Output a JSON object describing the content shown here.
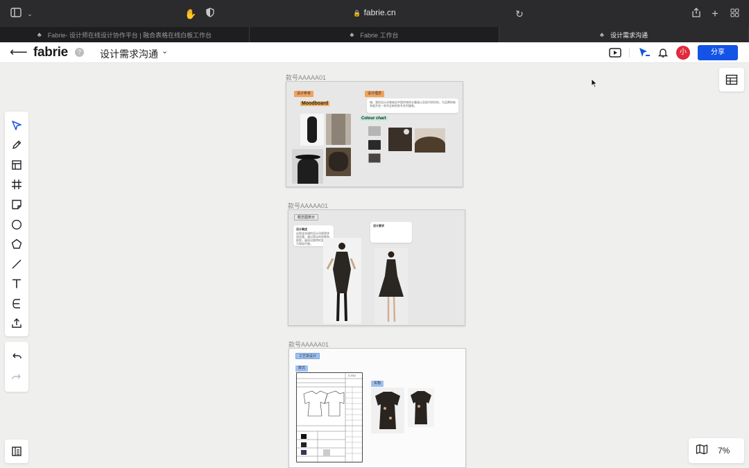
{
  "browser": {
    "url": "fabrie.cn",
    "tabs": [
      {
        "title": "Fabrie- 设计师在线设计协作平台 | 融合表格在线白板工作台",
        "active": false
      },
      {
        "title": "Fabrie 工作台",
        "active": false
      },
      {
        "title": "设计需求沟通",
        "active": true
      }
    ]
  },
  "app": {
    "logo": "fabrie",
    "help": "?",
    "doc_title": "设计需求沟通",
    "avatar_initial": "小",
    "share_label": "分享",
    "accent": "#1354e6",
    "avatar_color": "#e02a3d"
  },
  "toolbar": {
    "tools": [
      "select-icon",
      "pen-icon",
      "layout-icon",
      "frame-icon",
      "sticky-note-icon",
      "circle-icon",
      "pentagon-icon",
      "line-icon",
      "text-icon",
      "connector-icon",
      "upload-icon"
    ],
    "history": [
      "undo-icon",
      "redo-icon"
    ]
  },
  "canvas": {
    "zoom": "7%",
    "frames": [
      {
        "label": "款号AAAAA01",
        "tag_left": "设计参考",
        "tag_right": "设计理念",
        "moodboard": "Moodboard",
        "colour_chart": "Colour chart",
        "note_text": "嗨，我的设计灵感来自中国传统的水墨画以及现代的时尚，为品牌的新季度开发一系列全新的秋冬系列服装。"
      },
      {
        "label": "款号AAAAA01",
        "tag": "概念图表示",
        "note1_title": "设计概述",
        "note1_text": "这款连衣裙的设计风格是休闲优雅，通过简洁的剪裁和图案，展现出独特的女性魅力和现代感。",
        "note2_title": "设计要求"
      },
      {
        "label": "款号AAAAA01",
        "tag": "工艺单设计",
        "tag_small": "款式",
        "tag_photo": "实物",
        "sheet_title": "C-012"
      }
    ]
  }
}
